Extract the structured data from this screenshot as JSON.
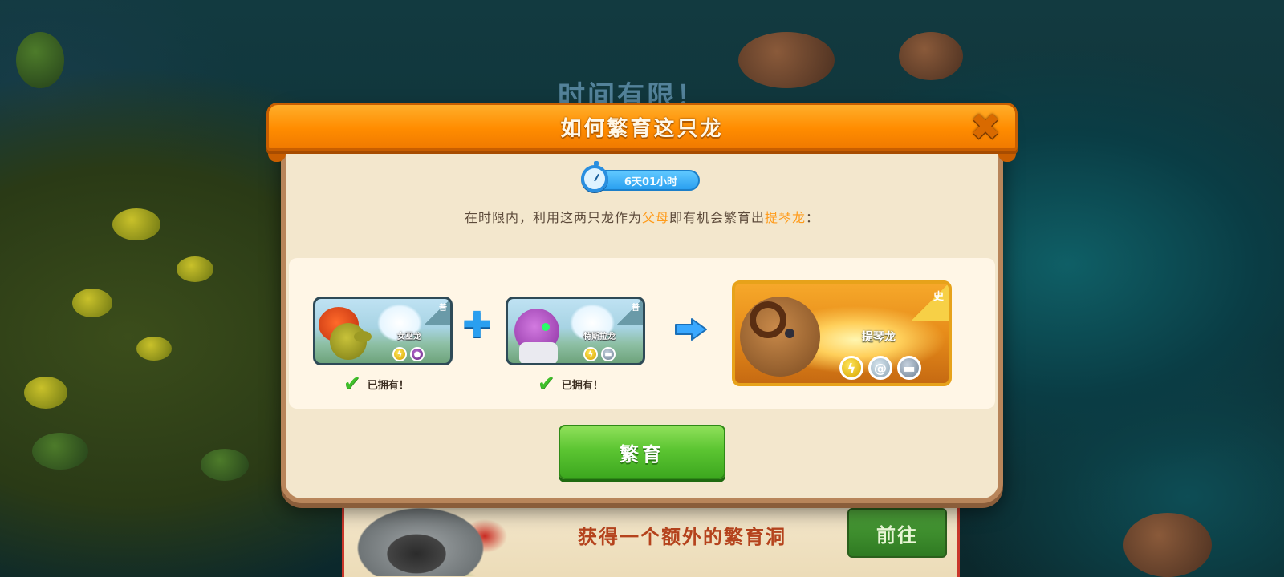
{
  "background": {
    "limited_time_text": "时间有限！"
  },
  "banner": {
    "text": "获得一个额外的繁育洞",
    "goto_label": "前往"
  },
  "dialog": {
    "title": "如何繁育这只龙",
    "close_icon": "close-x-icon",
    "timer": "6天01小时",
    "instruction": {
      "prefix": "在时限内，利用这两只龙作为",
      "highlight_parents": "父母",
      "middle": "即有机会繁育出",
      "highlight_target": "提琴龙",
      "suffix": "："
    },
    "parents": [
      {
        "name": "女巫龙",
        "rarity": "普",
        "elements": [
          "lightning",
          "dark"
        ],
        "owned_label": "已拥有！"
      },
      {
        "name": "特斯拉龙",
        "rarity": "普",
        "elements": [
          "lightning",
          "metal"
        ],
        "owned_label": "已拥有！"
      }
    ],
    "result": {
      "name": "提琴龙",
      "rarity": "史",
      "elements": [
        "lightning",
        "wind",
        "metal"
      ]
    },
    "breed_label": "繁育",
    "colors": {
      "header": "#ff8c00",
      "highlight": "#ff9b1a",
      "breed_button": "#5cc532",
      "timer": "#2a9ff0"
    }
  }
}
